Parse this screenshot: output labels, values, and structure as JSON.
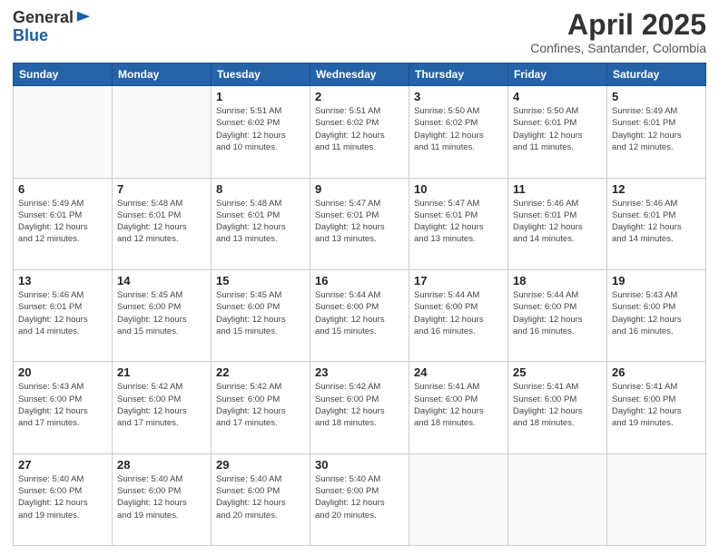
{
  "header": {
    "logo_line1": "General",
    "logo_line2": "Blue",
    "month": "April 2025",
    "location": "Confines, Santander, Colombia"
  },
  "weekdays": [
    "Sunday",
    "Monday",
    "Tuesday",
    "Wednesday",
    "Thursday",
    "Friday",
    "Saturday"
  ],
  "weeks": [
    [
      {
        "day": "",
        "info": ""
      },
      {
        "day": "",
        "info": ""
      },
      {
        "day": "1",
        "info": "Sunrise: 5:51 AM\nSunset: 6:02 PM\nDaylight: 12 hours\nand 10 minutes."
      },
      {
        "day": "2",
        "info": "Sunrise: 5:51 AM\nSunset: 6:02 PM\nDaylight: 12 hours\nand 11 minutes."
      },
      {
        "day": "3",
        "info": "Sunrise: 5:50 AM\nSunset: 6:02 PM\nDaylight: 12 hours\nand 11 minutes."
      },
      {
        "day": "4",
        "info": "Sunrise: 5:50 AM\nSunset: 6:01 PM\nDaylight: 12 hours\nand 11 minutes."
      },
      {
        "day": "5",
        "info": "Sunrise: 5:49 AM\nSunset: 6:01 PM\nDaylight: 12 hours\nand 12 minutes."
      }
    ],
    [
      {
        "day": "6",
        "info": "Sunrise: 5:49 AM\nSunset: 6:01 PM\nDaylight: 12 hours\nand 12 minutes."
      },
      {
        "day": "7",
        "info": "Sunrise: 5:48 AM\nSunset: 6:01 PM\nDaylight: 12 hours\nand 12 minutes."
      },
      {
        "day": "8",
        "info": "Sunrise: 5:48 AM\nSunset: 6:01 PM\nDaylight: 12 hours\nand 13 minutes."
      },
      {
        "day": "9",
        "info": "Sunrise: 5:47 AM\nSunset: 6:01 PM\nDaylight: 12 hours\nand 13 minutes."
      },
      {
        "day": "10",
        "info": "Sunrise: 5:47 AM\nSunset: 6:01 PM\nDaylight: 12 hours\nand 13 minutes."
      },
      {
        "day": "11",
        "info": "Sunrise: 5:46 AM\nSunset: 6:01 PM\nDaylight: 12 hours\nand 14 minutes."
      },
      {
        "day": "12",
        "info": "Sunrise: 5:46 AM\nSunset: 6:01 PM\nDaylight: 12 hours\nand 14 minutes."
      }
    ],
    [
      {
        "day": "13",
        "info": "Sunrise: 5:46 AM\nSunset: 6:01 PM\nDaylight: 12 hours\nand 14 minutes."
      },
      {
        "day": "14",
        "info": "Sunrise: 5:45 AM\nSunset: 6:00 PM\nDaylight: 12 hours\nand 15 minutes."
      },
      {
        "day": "15",
        "info": "Sunrise: 5:45 AM\nSunset: 6:00 PM\nDaylight: 12 hours\nand 15 minutes."
      },
      {
        "day": "16",
        "info": "Sunrise: 5:44 AM\nSunset: 6:00 PM\nDaylight: 12 hours\nand 15 minutes."
      },
      {
        "day": "17",
        "info": "Sunrise: 5:44 AM\nSunset: 6:00 PM\nDaylight: 12 hours\nand 16 minutes."
      },
      {
        "day": "18",
        "info": "Sunrise: 5:44 AM\nSunset: 6:00 PM\nDaylight: 12 hours\nand 16 minutes."
      },
      {
        "day": "19",
        "info": "Sunrise: 5:43 AM\nSunset: 6:00 PM\nDaylight: 12 hours\nand 16 minutes."
      }
    ],
    [
      {
        "day": "20",
        "info": "Sunrise: 5:43 AM\nSunset: 6:00 PM\nDaylight: 12 hours\nand 17 minutes."
      },
      {
        "day": "21",
        "info": "Sunrise: 5:42 AM\nSunset: 6:00 PM\nDaylight: 12 hours\nand 17 minutes."
      },
      {
        "day": "22",
        "info": "Sunrise: 5:42 AM\nSunset: 6:00 PM\nDaylight: 12 hours\nand 17 minutes."
      },
      {
        "day": "23",
        "info": "Sunrise: 5:42 AM\nSunset: 6:00 PM\nDaylight: 12 hours\nand 18 minutes."
      },
      {
        "day": "24",
        "info": "Sunrise: 5:41 AM\nSunset: 6:00 PM\nDaylight: 12 hours\nand 18 minutes."
      },
      {
        "day": "25",
        "info": "Sunrise: 5:41 AM\nSunset: 6:00 PM\nDaylight: 12 hours\nand 18 minutes."
      },
      {
        "day": "26",
        "info": "Sunrise: 5:41 AM\nSunset: 6:00 PM\nDaylight: 12 hours\nand 19 minutes."
      }
    ],
    [
      {
        "day": "27",
        "info": "Sunrise: 5:40 AM\nSunset: 6:00 PM\nDaylight: 12 hours\nand 19 minutes."
      },
      {
        "day": "28",
        "info": "Sunrise: 5:40 AM\nSunset: 6:00 PM\nDaylight: 12 hours\nand 19 minutes."
      },
      {
        "day": "29",
        "info": "Sunrise: 5:40 AM\nSunset: 6:00 PM\nDaylight: 12 hours\nand 20 minutes."
      },
      {
        "day": "30",
        "info": "Sunrise: 5:40 AM\nSunset: 6:00 PM\nDaylight: 12 hours\nand 20 minutes."
      },
      {
        "day": "",
        "info": ""
      },
      {
        "day": "",
        "info": ""
      },
      {
        "day": "",
        "info": ""
      }
    ]
  ]
}
